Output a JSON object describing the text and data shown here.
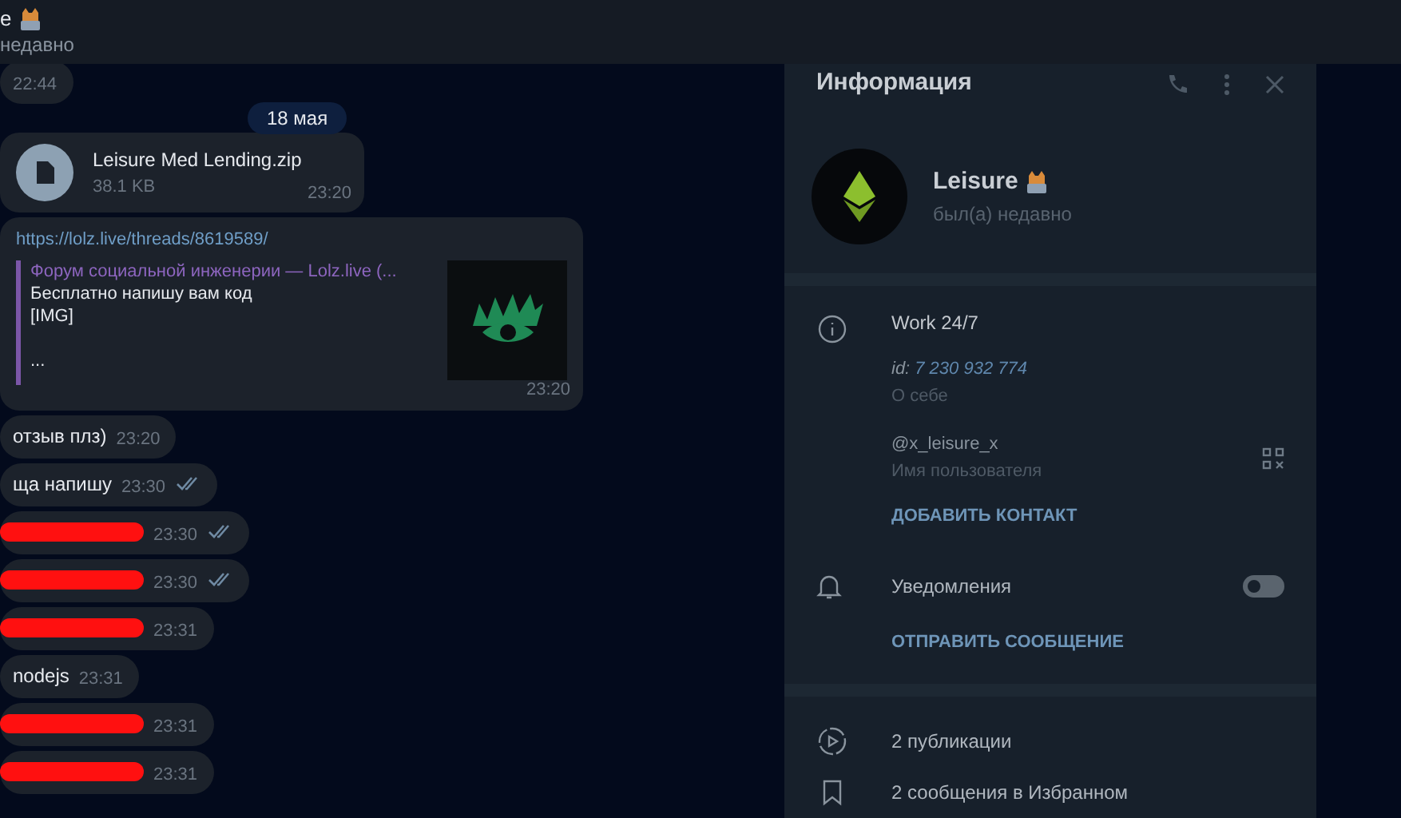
{
  "header": {
    "title": "e",
    "status": "недавно"
  },
  "messages": [
    {
      "kind": "text",
      "time": "22:44",
      "read": false,
      "redacted": false
    },
    {
      "kind": "date",
      "text": "18 мая"
    },
    {
      "kind": "file",
      "name": "Leisure Med Lending.zip",
      "size": "38.1 KB",
      "time": "23:20"
    },
    {
      "kind": "link",
      "url": "https://lolz.live/threads/8619589/",
      "site": "Форум социальной инженерии — Lolz.live (...",
      "desc": "Бесплатно напишу вам код",
      "lines": [
        "[IMG]",
        "..."
      ],
      "time": "23:20"
    },
    {
      "kind": "text",
      "text": "отзыв плз)",
      "time": "23:20",
      "read": false,
      "redacted": false
    },
    {
      "kind": "text",
      "text": "ща напишу",
      "time": "23:30",
      "read": true,
      "redacted": false
    },
    {
      "kind": "text",
      "time": "23:30",
      "read": true,
      "redacted": true
    },
    {
      "kind": "text",
      "time": "23:30",
      "read": true,
      "redacted": true
    },
    {
      "kind": "text",
      "time": "23:31",
      "read": false,
      "redacted": true
    },
    {
      "kind": "text",
      "text": "nodejs",
      "time": "23:31",
      "read": false,
      "redacted": false
    },
    {
      "kind": "text",
      "time": "23:31",
      "read": false,
      "redacted": true
    },
    {
      "kind": "text",
      "time": "23:31",
      "read": false,
      "redacted": true
    }
  ],
  "info_panel": {
    "title": "Информация",
    "name": "Leisure",
    "status": "был(а) недавно",
    "bio": "Work 24/7",
    "id_label": "id:",
    "id_value": "7 230 932 774",
    "bio_caption": "О себе",
    "username": "@x_leisure_x",
    "username_caption": "Имя пользователя",
    "add_contact": "ДОБАВИТЬ КОНТАКТ",
    "notifications": {
      "label": "Уведомления",
      "on": false
    },
    "send_message": "ОТПРАВИТЬ СООБЩЕНИЕ",
    "stats": [
      {
        "kind": "posts",
        "label": "2 публикации"
      },
      {
        "kind": "saved",
        "label": "2 сообщения в Избранном"
      }
    ]
  }
}
